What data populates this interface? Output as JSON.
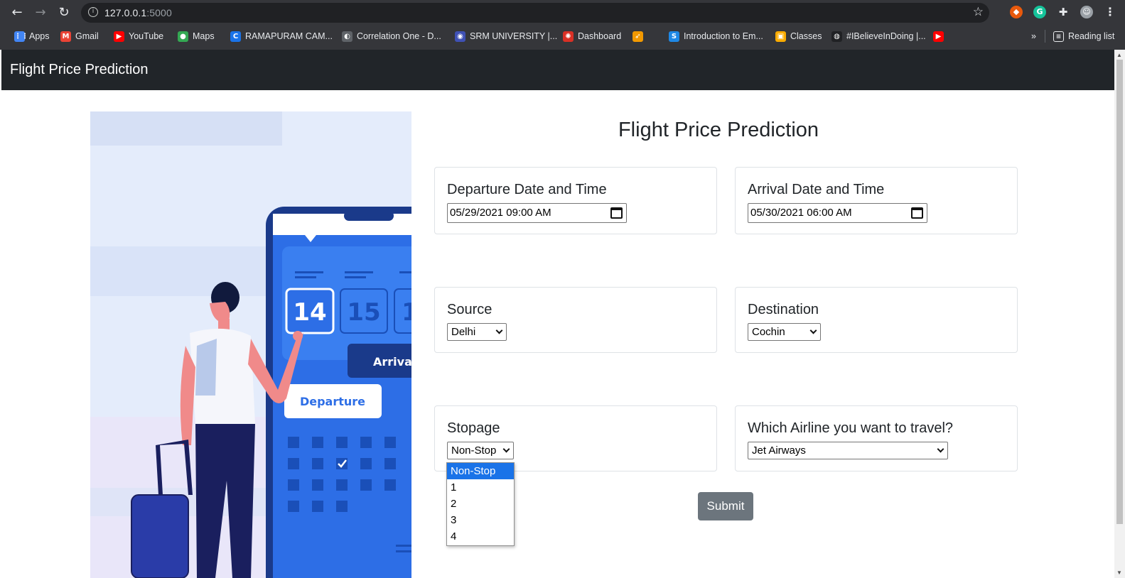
{
  "browser": {
    "url_host": "127.0.0.1",
    "url_port": ":5000",
    "bookmarks": [
      {
        "label": "Apps",
        "color": "#4285f4",
        "glyph": "⋮⋮"
      },
      {
        "label": "Gmail",
        "color": "#ea4335",
        "glyph": "M"
      },
      {
        "label": "YouTube",
        "color": "#ff0000",
        "glyph": "▶"
      },
      {
        "label": "Maps",
        "color": "#34a853",
        "glyph": "●"
      },
      {
        "label": "RAMAPURAM CAM...",
        "color": "#1a73e8",
        "glyph": "C"
      },
      {
        "label": "Correlation One - D...",
        "color": "#5f6368",
        "glyph": "◐"
      },
      {
        "label": "SRM UNIVERSITY |...",
        "color": "#3f51b5",
        "glyph": "◉"
      },
      {
        "label": "Dashboard",
        "color": "#d93025",
        "glyph": "✺"
      },
      {
        "label": "",
        "color": "#f29900",
        "glyph": "➶"
      },
      {
        "label": "Introduction to Em...",
        "color": "#1e88e5",
        "glyph": "S"
      },
      {
        "label": "Classes",
        "color": "#f9ab00",
        "glyph": "▣"
      },
      {
        "label": "#IBelieveInDoing |...",
        "color": "#202124",
        "glyph": "◍"
      },
      {
        "label": "",
        "color": "#ff0000",
        "glyph": "▶"
      }
    ],
    "more_label": "»",
    "reading_list_label": "Reading list"
  },
  "navbar": {
    "brand": "Flight Price Prediction"
  },
  "main": {
    "heading": "Flight Price Prediction",
    "departure": {
      "label": "Departure Date and Time",
      "value": "05/29/2021 09:00  AM"
    },
    "arrival": {
      "label": "Arrival Date and Time",
      "value": "05/30/2021 06:00  AM"
    },
    "source": {
      "label": "Source",
      "value": "Delhi"
    },
    "destination": {
      "label": "Destination",
      "value": "Cochin"
    },
    "stopage": {
      "label": "Stopage",
      "value": "Non-Stop",
      "options": [
        "Non-Stop",
        "1",
        "2",
        "3",
        "4"
      ]
    },
    "airline": {
      "label": "Which Airline you want to travel?",
      "value": "Jet Airways"
    },
    "submit_label": "Submit"
  },
  "illustration": {
    "dates": [
      "14",
      "15",
      "1"
    ],
    "departure_label": "Departure",
    "arrival_label": "Arriva"
  },
  "colors": {
    "navbar_bg": "#212529",
    "submit_bg": "#6c757d",
    "phone_blue": "#2d6ee6",
    "option_highlight": "#1a73e8"
  }
}
